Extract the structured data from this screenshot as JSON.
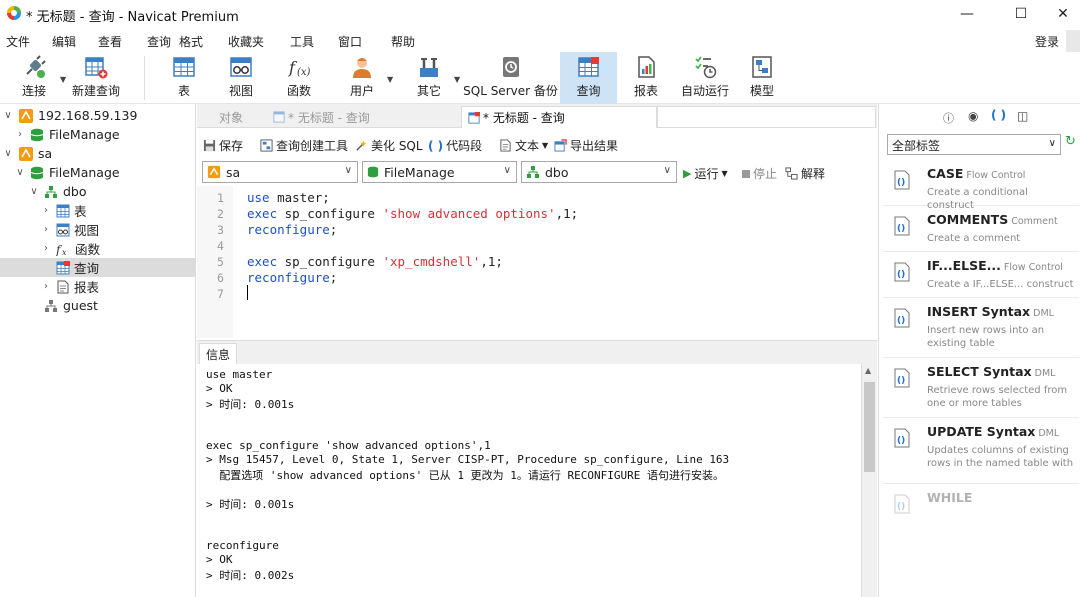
{
  "window": {
    "title": "* 无标题 - 查询 - Navicat Premium",
    "minimize": "—",
    "maximize": "☐",
    "close": "✕"
  },
  "menu": [
    "文件",
    "编辑",
    "查看",
    "查询",
    "格式",
    "收藏夹",
    "工具",
    "窗口",
    "帮助"
  ],
  "login": "登录",
  "toolbar": {
    "connect": "连接",
    "new_query": "新建查询",
    "table": "表",
    "view": "视图",
    "function": "函数",
    "user": "用户",
    "other": "其它",
    "sqlserver_backup": "SQL Server 备份",
    "query": "查询",
    "report": "报表",
    "automation": "自动运行",
    "model": "模型"
  },
  "tree": {
    "conn1": "192.168.59.139",
    "conn1_db": "FileManage",
    "conn2": "sa",
    "conn2_db": "FileManage",
    "schema": "dbo",
    "tables": "表",
    "views": "视图",
    "functions": "函数",
    "queries": "查询",
    "reports": "报表",
    "guest": "guest"
  },
  "tabs": {
    "objects": "对象",
    "inactive": "* 无标题 - 查询",
    "active": "* 无标题 - 查询"
  },
  "query_toolbar": {
    "save": "保存",
    "builder": "查询创建工具",
    "beautify": "美化 SQL",
    "snippet": "代码段",
    "text": "文本",
    "export": "导出结果",
    "run": "运行",
    "stop": "停止",
    "explain": "解释"
  },
  "selectors": {
    "connection": "sa",
    "database": "FileManage",
    "schema": "dbo"
  },
  "editor": {
    "line_numbers": [
      "1",
      "2",
      "3",
      "4",
      "5",
      "6",
      "7"
    ],
    "l1_kw": "use",
    "l1_rest": " master;",
    "l2_kw": "exec",
    "l2_mid": " sp_configure ",
    "l2_str": "'show advanced options'",
    "l2_end": ",1;",
    "l3_kw": "reconfigure",
    "l3_end": ";",
    "l5_kw": "exec",
    "l5_mid": " sp_configure ",
    "l5_str": "'xp_cmdshell'",
    "l5_end": ",1;",
    "l6_kw": "reconfigure",
    "l6_end": ";"
  },
  "info": {
    "tab": "信息",
    "lines": [
      "use master",
      "> OK",
      "> 时间: 0.001s",
      "exec sp_configure 'show advanced options',1",
      "> Msg 15457, Level 0, State 1, Server CISP-PT, Procedure sp_configure, Line 163",
      "  配置选项 'show advanced options' 已从 1 更改为 1。请运行 RECONFIGURE 语句进行安装。",
      "> 时间: 0.001s",
      "reconfigure",
      "> OK",
      "> 时间: 0.002s"
    ]
  },
  "right_panel": {
    "filter": "全部标签",
    "snippets": [
      {
        "name": "CASE",
        "category": "Flow Control",
        "desc": "Create a conditional construct"
      },
      {
        "name": "COMMENTS",
        "category": "Comment",
        "desc": "Create a comment"
      },
      {
        "name": "IF...ELSE...",
        "category": "Flow Control",
        "desc": "Create a IF...ELSE... construct"
      },
      {
        "name": "INSERT Syntax",
        "category": "DML",
        "desc": "Insert new rows into an existing table"
      },
      {
        "name": "SELECT Syntax",
        "category": "DML",
        "desc": "Retrieve rows selected from one or more tables"
      },
      {
        "name": "UPDATE Syntax",
        "category": "DML",
        "desc": "Updates columns of existing rows in the named table with"
      },
      {
        "name": "WHILE",
        "category": "",
        "desc": ""
      }
    ]
  }
}
